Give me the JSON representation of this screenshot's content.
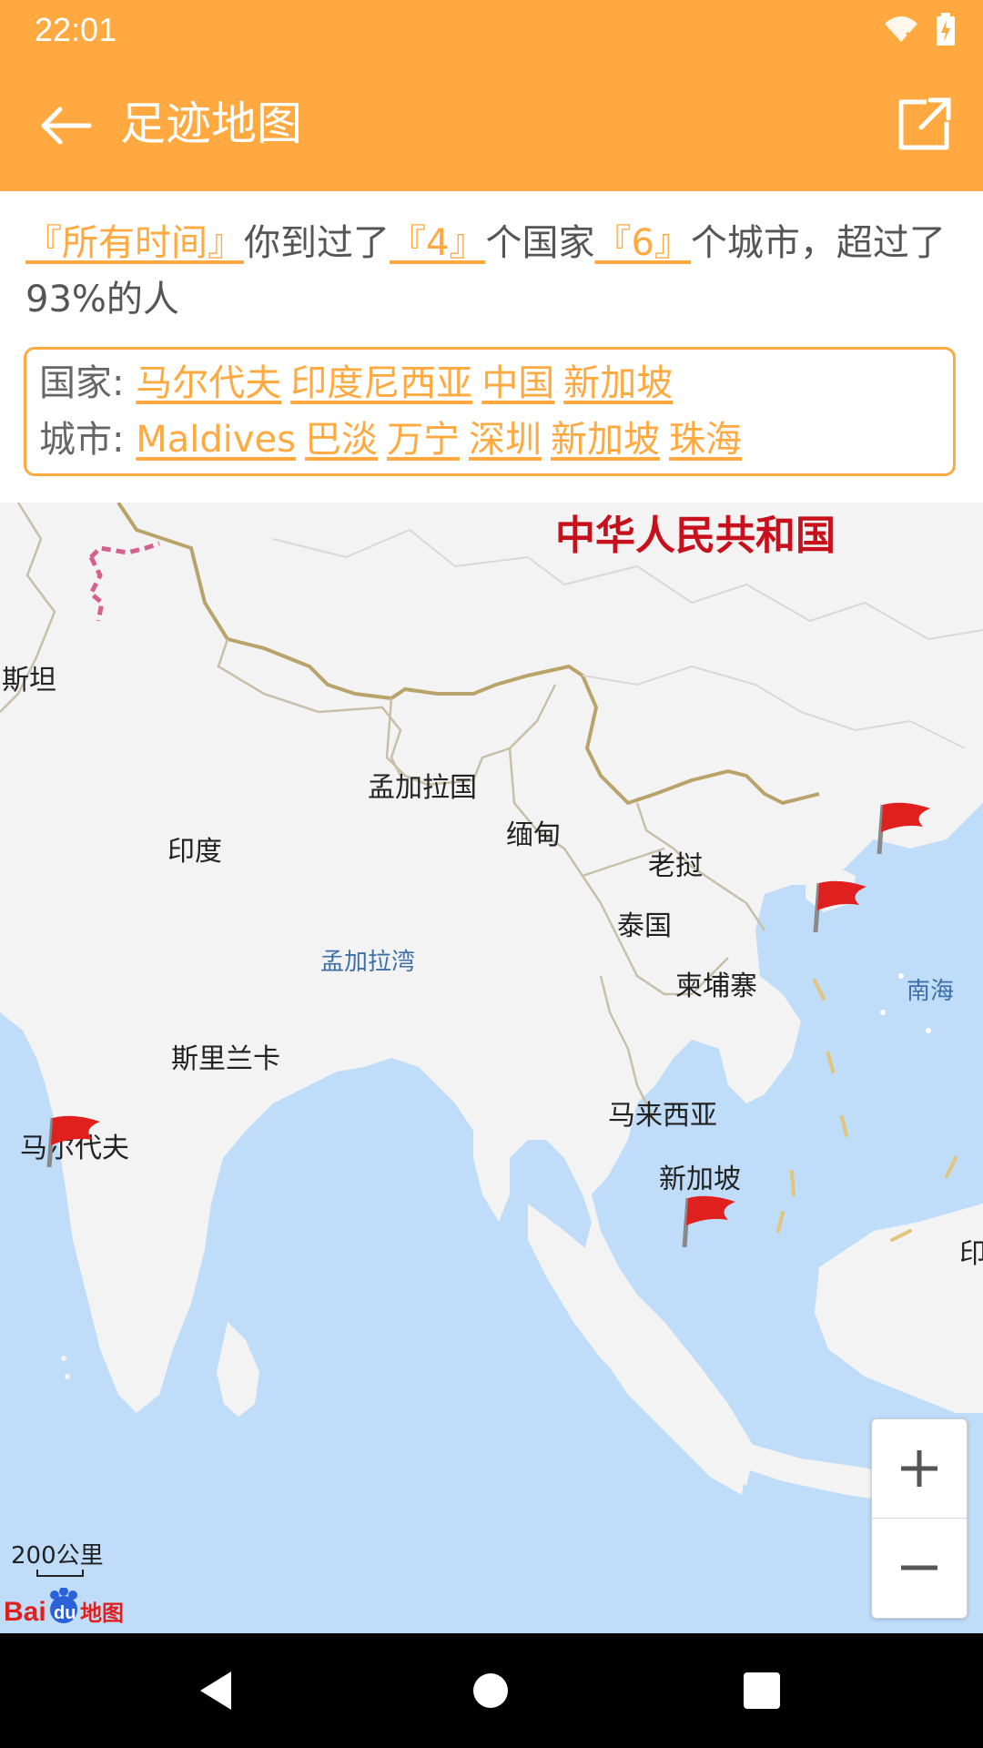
{
  "status": {
    "time": "22:01",
    "icons": [
      "wifi-icon",
      "battery-charging-icon"
    ]
  },
  "app_bar": {
    "title": "足迹地图",
    "back_icon": "arrow-left-icon",
    "share_icon": "share-icon"
  },
  "summary": {
    "period": "『所有时间』",
    "text_been": "你到过了",
    "countries_count": "『4』",
    "text_countries": "个国家",
    "cities_count": "『6』",
    "text_cities": "个城市，超过了93%的人"
  },
  "visited": {
    "countries_label": "国家:",
    "countries": [
      "马尔代夫",
      "印度尼西亚",
      "中国",
      "新加坡"
    ],
    "cities_label": "城市:",
    "cities": [
      "Maldives",
      "巴淡",
      "万宁",
      "深圳",
      "新加坡",
      "珠海"
    ]
  },
  "map": {
    "labels": {
      "china": "中华人民共和国",
      "pakistan": "斯坦",
      "bangladesh": "孟加拉国",
      "myanmar": "缅甸",
      "india": "印度",
      "laos": "老挝",
      "thailand": "泰国",
      "bay_of_bengal": "孟加拉湾",
      "cambodia": "柬埔寨",
      "south_sea": "南海",
      "sri_lanka": "斯里兰卡",
      "malaysia": "马来西亚",
      "maldives": "马尔代夫",
      "singapore": "新加坡",
      "indonesia_partial": "印"
    },
    "scale": "200公里",
    "zoom_in_icon": "plus-icon",
    "zoom_out_icon": "minus-icon",
    "logo": "Baidu地图",
    "colors": {
      "sea": "#BFDCF8",
      "land": "#F3F3F3",
      "border": "#B8A36A",
      "flag": "#E0201E"
    }
  },
  "nav": {
    "back_icon": "nav-back-icon",
    "home_icon": "nav-home-icon",
    "recents_icon": "nav-recents-icon"
  },
  "theme": {
    "accent": "#FFA940"
  }
}
